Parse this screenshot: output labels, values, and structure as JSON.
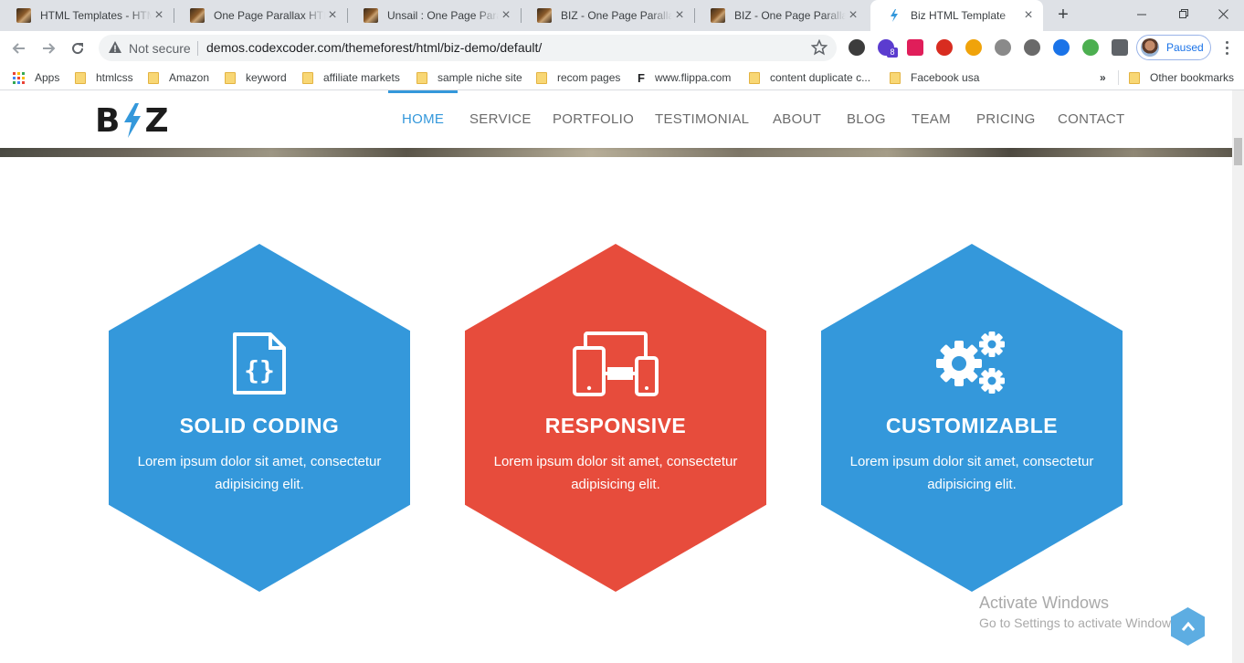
{
  "browser": {
    "tabs": [
      {
        "title": "HTML Templates - HTML"
      },
      {
        "title": "One Page Parallax HTML"
      },
      {
        "title": "Unsail : One Page Paral"
      },
      {
        "title": "BIZ - One Page Parallax"
      },
      {
        "title": "BIZ - One Page Parallax"
      },
      {
        "title": "Biz HTML Template"
      }
    ],
    "address": {
      "security_label": "Not secure",
      "url": "demos.codexcoder.com/themeforest/html/biz-demo/default/"
    },
    "extensions": [
      {
        "icon": "k-extension-icon",
        "color": "#3c3c3c"
      },
      {
        "icon": "badge-8-extension-icon",
        "color": "#5b3ccf"
      },
      {
        "icon": "slack-extension-icon",
        "color": "#e01e5a"
      },
      {
        "icon": "pdf-extension-icon",
        "color": "#d82c20"
      },
      {
        "icon": "pro-extension-icon",
        "color": "#f0a30a"
      },
      {
        "icon": "globe-extension-icon",
        "color": "#8a8a8a"
      },
      {
        "icon": "gear-extension-icon",
        "color": "#6a6a6a"
      },
      {
        "icon": "code-extension-icon",
        "color": "#1a73e8"
      },
      {
        "icon": "download-extension-icon",
        "color": "#4caf50"
      },
      {
        "icon": "puzzle-extension-icon",
        "color": "#5f6368"
      }
    ],
    "extension_badge": "8",
    "profile_label": "Paused",
    "bookmarks": [
      {
        "label": "Apps",
        "type": "apps"
      },
      {
        "label": "htmlcss",
        "type": "folder"
      },
      {
        "label": "Amazon",
        "type": "folder"
      },
      {
        "label": "keyword",
        "type": "folder"
      },
      {
        "label": "affiliate markets",
        "type": "folder"
      },
      {
        "label": "sample niche site",
        "type": "folder"
      },
      {
        "label": "recom pages",
        "type": "folder"
      },
      {
        "label": "www.flippa.com",
        "type": "site"
      },
      {
        "label": "content duplicate c...",
        "type": "folder"
      },
      {
        "label": "Facebook usa",
        "type": "folder"
      }
    ],
    "bookmarks_overflow": "»",
    "other_bookmarks": "Other bookmarks"
  },
  "site": {
    "logo": {
      "left": "B",
      "right": "Z"
    },
    "menu": [
      "HOME",
      "SERVICE",
      "PORTFOLIO",
      "TESTIMONIAL",
      "ABOUT",
      "BLOG",
      "TEAM",
      "PRICING",
      "CONTACT"
    ],
    "active_menu": "HOME",
    "features": [
      {
        "title": "SOLID CODING",
        "desc": "Lorem ipsum dolor sit amet, consectetur adipisicing elit.",
        "color": "#3498db",
        "icon": "code-file-icon"
      },
      {
        "title": "RESPONSIVE",
        "desc": "Lorem ipsum dolor sit amet, consectetur adipisicing elit.",
        "color": "#e74c3c",
        "icon": "devices-icon"
      },
      {
        "title": "CUSTOMIZABLE",
        "desc": "Lorem ipsum dolor sit amet, consectetur adipisicing elit.",
        "color": "#3498db",
        "icon": "gears-icon"
      }
    ]
  },
  "os_overlay": {
    "activate_title": "Activate Windows",
    "activate_sub": "Go to Settings to activate Windows."
  }
}
